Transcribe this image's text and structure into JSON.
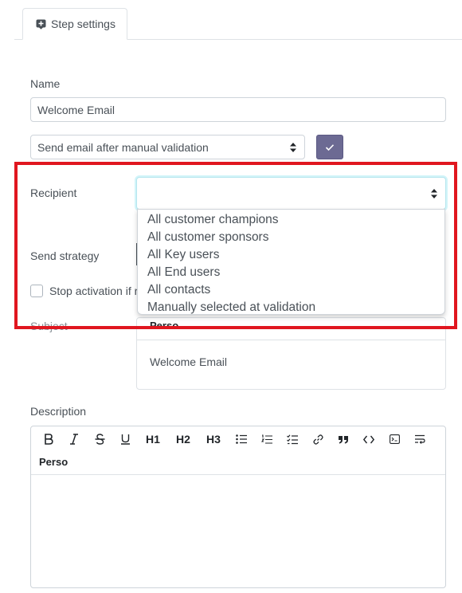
{
  "tab": {
    "label": "Step settings",
    "icon": "plus-square-icon"
  },
  "name": {
    "label": "Name",
    "value": "Welcome Email"
  },
  "trigger": {
    "value": "Send email after manual validation"
  },
  "recipient": {
    "label": "Recipient",
    "value": "",
    "options": [
      "All customer champions",
      "All customer sponsors",
      "All Key users",
      "All End users",
      "All contacts",
      "Manually selected at validation"
    ]
  },
  "send_strategy": {
    "label": "Send strategy"
  },
  "stop_activation": {
    "label": "Stop activation if r"
  },
  "subject": {
    "label": "Subject",
    "perso_label": "Perso",
    "value": "Welcome Email"
  },
  "description": {
    "label": "Description",
    "toolbar": {
      "h1": "H1",
      "h2": "H2",
      "h3": "H3",
      "perso": "Perso"
    }
  },
  "colors": {
    "accent": "#6c6a93",
    "highlight": "#e0161f",
    "focus": "#d2f4f9"
  }
}
